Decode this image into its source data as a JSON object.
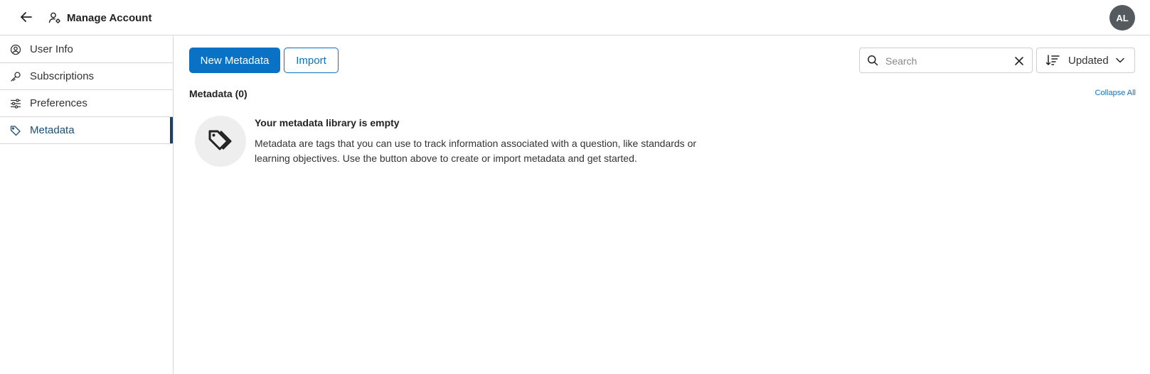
{
  "header": {
    "title": "Manage Account",
    "avatar_initials": "AL",
    "avatar_color": "#555a5f"
  },
  "sidebar": {
    "items": [
      {
        "label": "User Info",
        "icon": "user-circle-icon"
      },
      {
        "label": "Subscriptions",
        "icon": "key-icon"
      },
      {
        "label": "Preferences",
        "icon": "sliders-icon"
      },
      {
        "label": "Metadata",
        "icon": "tag-icon",
        "active": true
      }
    ]
  },
  "toolbar": {
    "new_label": "New Metadata",
    "import_label": "Import",
    "search_placeholder": "Search",
    "search_value": "",
    "sort_label": "Updated"
  },
  "section": {
    "title": "Metadata (0)",
    "collapse_label": "Collapse All"
  },
  "empty": {
    "heading": "Your metadata library is empty",
    "body": "Metadata are tags that you can use to track information associated with a question, like standards or learning objectives. Use the button above to create or import metadata and get started."
  },
  "colors": {
    "primary": "#0a72c4",
    "active_indicator": "#1d3f66",
    "border": "#d6d6d6"
  }
}
